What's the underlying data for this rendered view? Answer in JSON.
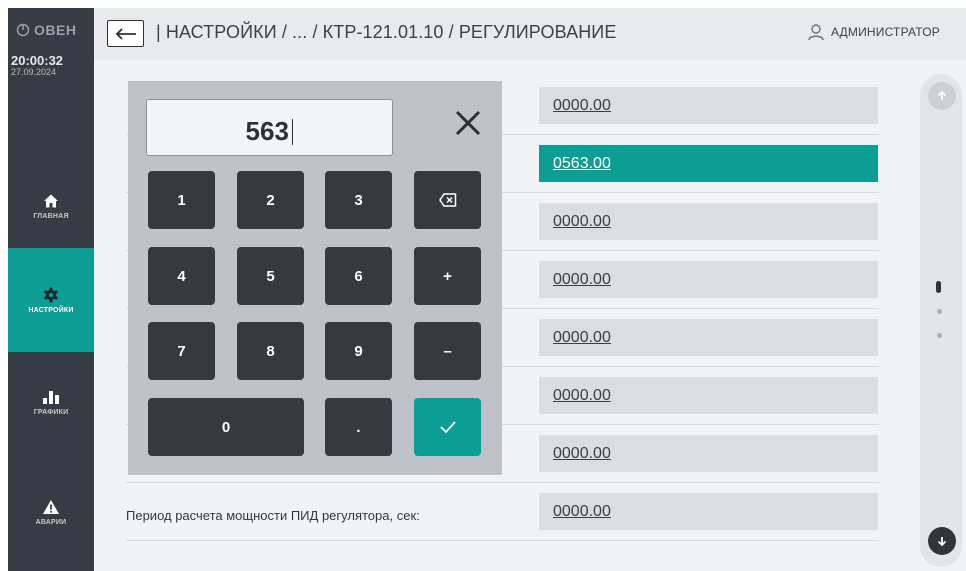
{
  "app": {
    "brand": "ОВЕН"
  },
  "clock": {
    "time": "20:00:32",
    "date": "27.09.2024"
  },
  "sidebar": {
    "items": [
      {
        "label": "ГЛАВНАЯ",
        "icon": "home-icon",
        "active": false
      },
      {
        "label": "НАСТРОЙКИ",
        "icon": "gear-icon",
        "active": true
      },
      {
        "label": "ГРАФИКИ",
        "icon": "bar-chart-icon",
        "active": false
      },
      {
        "label": "АВАРИИ",
        "icon": "warning-icon",
        "active": false
      }
    ]
  },
  "header": {
    "breadcrumb": "| НАСТРОЙКИ / ... / КТР-121.01.10 / РЕГУЛИРОВАНИЕ",
    "user": "АДМИНИСТРАТОР"
  },
  "settings": {
    "rows": [
      {
        "label": "",
        "value": "0000.00",
        "active": false
      },
      {
        "label": "",
        "value": "0563.00",
        "active": true
      },
      {
        "label": "",
        "value": "0000.00",
        "active": false
      },
      {
        "label": "",
        "value": "0000.00",
        "active": false
      },
      {
        "label": "",
        "value": "0000.00",
        "active": false
      },
      {
        "label": "",
        "value": "0000.00",
        "active": false
      },
      {
        "label": "",
        "value": "0000.00",
        "active": false
      },
      {
        "label": "Период расчета мощности ПИД регулятора, сек:",
        "value": "0000.00",
        "active": false
      }
    ]
  },
  "keypad": {
    "display": "563",
    "keys": {
      "k1": "1",
      "k2": "2",
      "k3": "3",
      "k4": "4",
      "k5": "5",
      "k6": "6",
      "k7": "7",
      "k8": "8",
      "k9": "9",
      "k0": "0",
      "dot": ".",
      "plus": "+",
      "minus": "–"
    }
  },
  "colors": {
    "accent": "#0c9e95",
    "sidebar": "#363c43",
    "key": "#353a40",
    "keypad_bg": "#bfc3c8"
  }
}
